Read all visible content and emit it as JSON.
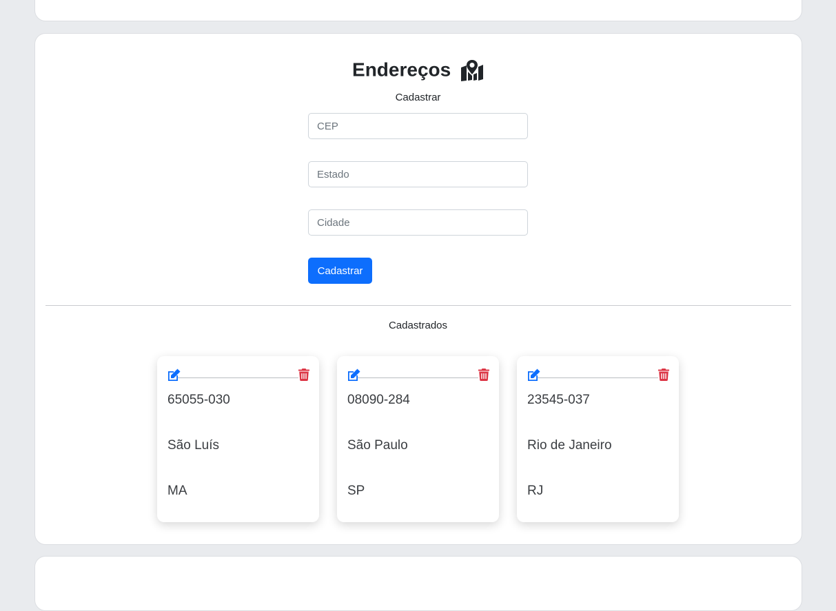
{
  "section": {
    "title": "Endereços",
    "title_icon": "map-location-icon",
    "form_heading": "Cadastrar",
    "list_heading": "Cadastrados"
  },
  "form": {
    "cep_placeholder": "CEP",
    "estado_placeholder": "Estado",
    "cidade_placeholder": "Cidade",
    "submit_label": "Cadastrar"
  },
  "addresses": [
    {
      "cep": "65055-030",
      "cidade": "São Luís",
      "estado": "MA"
    },
    {
      "cep": "08090-284",
      "cidade": "São Paulo",
      "estado": "SP"
    },
    {
      "cep": "23545-037",
      "cidade": "Rio de Janeiro",
      "estado": "RJ"
    }
  ],
  "colors": {
    "primary": "#0d6efd",
    "danger": "#dc3545",
    "background": "#e9ebee"
  }
}
